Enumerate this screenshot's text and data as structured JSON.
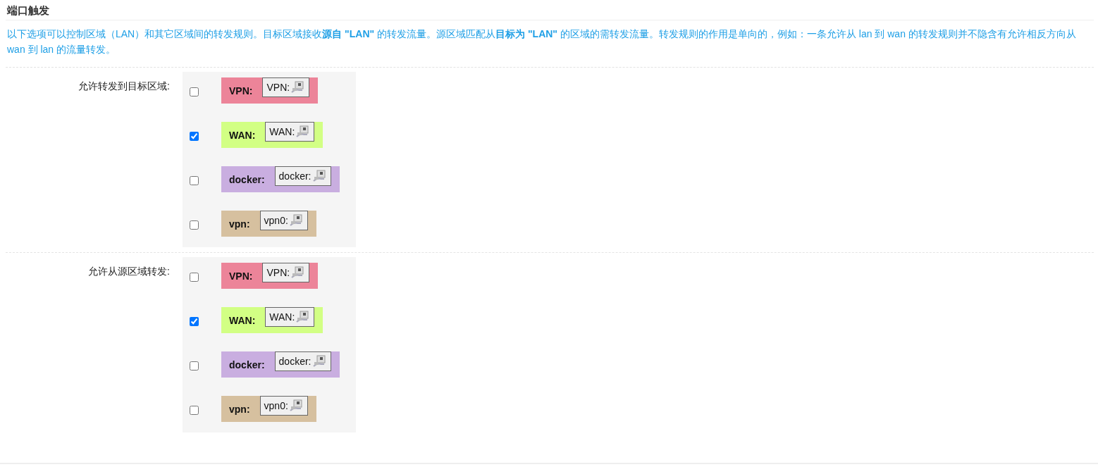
{
  "section": {
    "title": "端口触发",
    "description": "以下选项可以控制区域（LAN）和其它区域间的转发规则。目标区域接收**源自 \"LAN\"** 的转发流量。源区域匹配从**目标为 \"LAN\"** 的区域的需转发流量。转发规则的作用是单向的，例如：一条允许从 lan 到 wan 的转发规则并不隐含有允许相反方向从 wan 到 lan 的流量转发。"
  },
  "fields": [
    {
      "label": "允许转发到目标区域:",
      "zones": [
        {
          "name": "VPN:",
          "network": "VPN:",
          "color": "#ec8499",
          "checked": false
        },
        {
          "name": "WAN:",
          "network": "WAN:",
          "color": "#d2ff84",
          "checked": true
        },
        {
          "name": "docker:",
          "network": "docker:",
          "color": "#c9aee0",
          "checked": false
        },
        {
          "name": "vpn:",
          "network": "vpn0:",
          "color": "#d6c09f",
          "checked": false
        }
      ]
    },
    {
      "label": "允许从源区域转发:",
      "zones": [
        {
          "name": "VPN:",
          "network": "VPN:",
          "color": "#ec8499",
          "checked": false
        },
        {
          "name": "WAN:",
          "network": "WAN:",
          "color": "#d2ff84",
          "checked": true
        },
        {
          "name": "docker:",
          "network": "docker:",
          "color": "#c9aee0",
          "checked": false
        },
        {
          "name": "vpn:",
          "network": "vpn0:",
          "color": "#d6c09f",
          "checked": false
        }
      ]
    }
  ]
}
